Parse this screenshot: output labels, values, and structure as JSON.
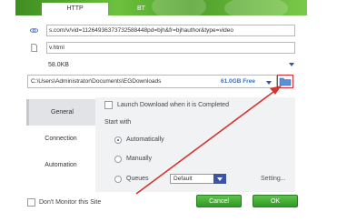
{
  "tabs": [
    {
      "label": "HTTP"
    },
    {
      "label": "BT"
    }
  ],
  "url_field": {
    "value": "s.com/v/vid=11264936373732588448pd=bjh&fr=bjhauthor&type=video"
  },
  "filename_field": {
    "value": "v.html"
  },
  "file_size": "58.0KB",
  "save_path": {
    "value": "C:\\Users\\Administrator\\Documents\\EGDownloads",
    "free_space": "61.0GB Free"
  },
  "sidebar": {
    "items": [
      {
        "label": "General"
      },
      {
        "label": "Connection"
      },
      {
        "label": "Automation"
      }
    ]
  },
  "general": {
    "launch_download_label": "Launch Download when it is Completed",
    "start_with_label": "Start with",
    "options": [
      {
        "label": "Automatically"
      },
      {
        "label": "Manually"
      },
      {
        "label": "Queues"
      }
    ],
    "queue_select_value": "Default",
    "setting_link": "Setting..."
  },
  "footer": {
    "dont_monitor_label": "Don't Monitor this Site",
    "cancel_label": "Cancel",
    "ok_label": "OK"
  },
  "colors": {
    "accent_green": "#3a9f2d",
    "annotation_red": "#d63333",
    "link_blue": "#3b6fb6"
  }
}
